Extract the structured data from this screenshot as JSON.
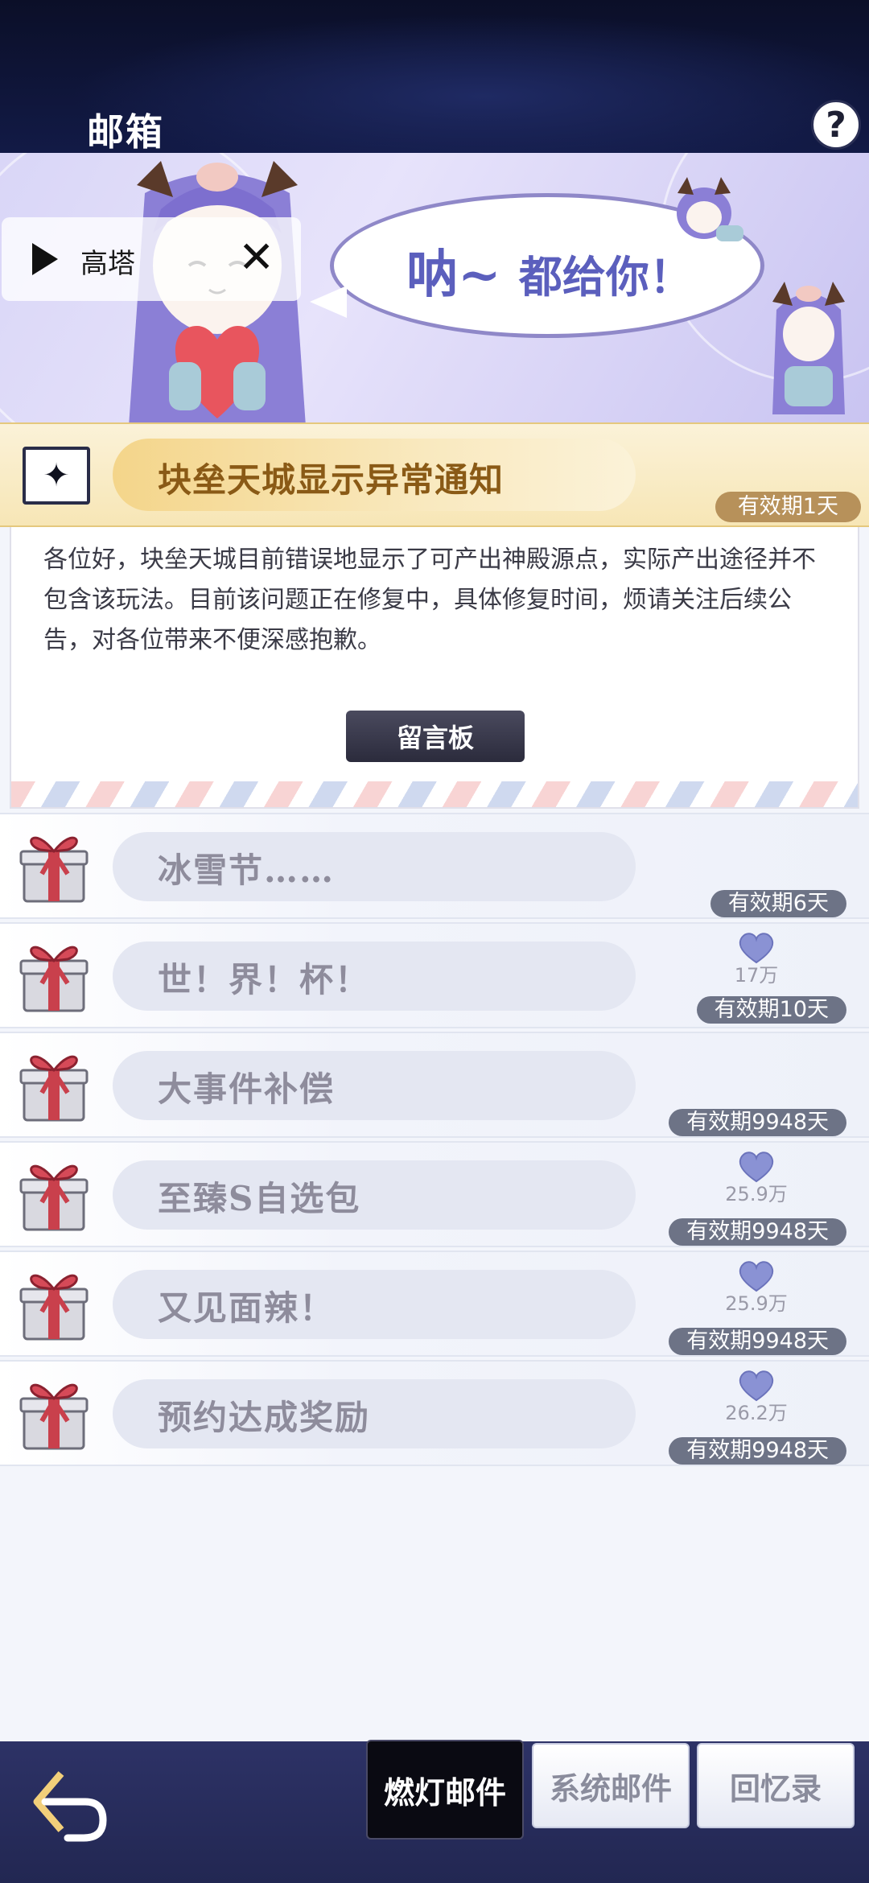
{
  "header": {
    "title": "邮箱",
    "help_label": "?"
  },
  "banner": {
    "speech_big": "呐~",
    "speech_rest": "都给你！",
    "music": {
      "track": "高塔",
      "close_label": "✕"
    }
  },
  "featured_mail": {
    "title": "块垒天城显示异常通知",
    "expiry": "有效期1天",
    "body": "各位好，块垒天城目前错误地显示了可产出神殿源点，实际产出途径并不包含该玩法。目前该问题正在修复中，具体修复时间，烦请关注后续公告，对各位带来不便深感抱歉。",
    "button_label": "留言板"
  },
  "mails": [
    {
      "title": "冰雪节……",
      "amount": null,
      "expiry": "有效期6天"
    },
    {
      "title": "世！界！杯！",
      "amount": "17万",
      "expiry": "有效期10天"
    },
    {
      "title": "大事件补偿",
      "amount": null,
      "expiry": "有效期9948天"
    },
    {
      "title": "至臻S自选包",
      "amount": "25.9万",
      "expiry": "有效期9948天"
    },
    {
      "title": "又见面辣！",
      "amount": "25.9万",
      "expiry": "有效期9948天"
    },
    {
      "title": "预约达成奖励",
      "amount": "26.2万",
      "expiry": "有效期9948天"
    }
  ],
  "tabs": {
    "active": "燃灯邮件",
    "system": "系统邮件",
    "memory": "回忆录"
  },
  "colors": {
    "header_bg": "#0b0f28",
    "gold_badge": "#b7915a",
    "grey_badge": "#6d7386",
    "bottom_bar": "#2d3266",
    "speech_text": "#5b5fbd"
  }
}
